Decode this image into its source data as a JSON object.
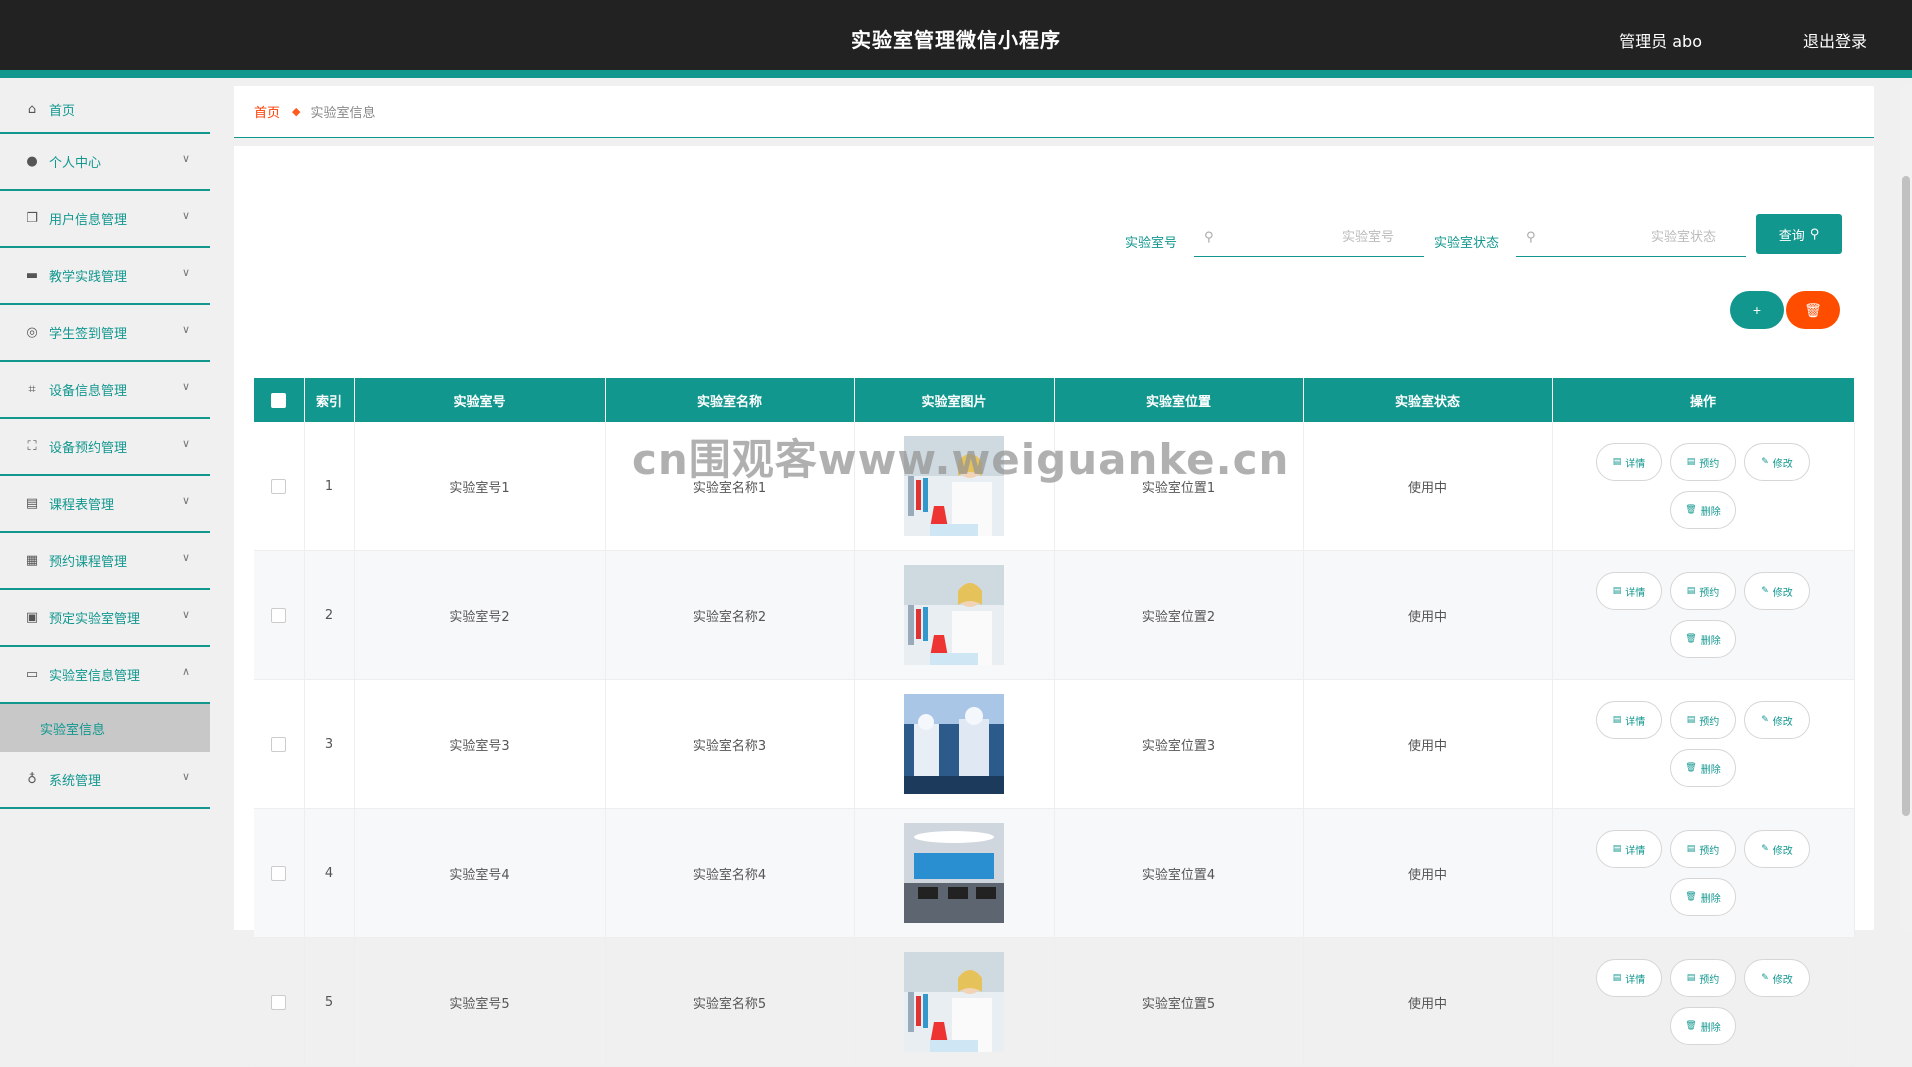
{
  "header": {
    "title": "实验室管理微信小程序",
    "user": "管理员 abo",
    "logout": "退出登录"
  },
  "sidebar": {
    "items": [
      {
        "label": "首页",
        "icon": "home-icon",
        "glyph": "⌂",
        "chevron": ""
      },
      {
        "label": "个人中心",
        "icon": "user-icon",
        "glyph": "●",
        "chevron": "∨"
      },
      {
        "label": "用户信息管理",
        "icon": "copy-icon",
        "glyph": "❐",
        "chevron": "∨"
      },
      {
        "label": "教学实践管理",
        "icon": "monitor-icon",
        "glyph": "▬",
        "chevron": "∨"
      },
      {
        "label": "学生签到管理",
        "icon": "target-icon",
        "glyph": "◎",
        "chevron": "∨"
      },
      {
        "label": "设备信息管理",
        "icon": "crop-icon",
        "glyph": "⌗",
        "chevron": "∨"
      },
      {
        "label": "设备预约管理",
        "icon": "fullscreen-icon",
        "glyph": "⛶",
        "chevron": "∨"
      },
      {
        "label": "课程表管理",
        "icon": "briefcase-icon",
        "glyph": "▤",
        "chevron": "∨"
      },
      {
        "label": "预约课程管理",
        "icon": "grid-icon",
        "glyph": "▦",
        "chevron": "∨"
      },
      {
        "label": "预定实验室管理",
        "icon": "clipboard-icon",
        "glyph": "▣",
        "chevron": "∨"
      },
      {
        "label": "实验室信息管理",
        "icon": "laptop-icon",
        "glyph": "▭",
        "chevron": "∧"
      },
      {
        "label": "实验室信息",
        "sub": true
      },
      {
        "label": "系统管理",
        "icon": "microphone-icon",
        "glyph": "♁",
        "chevron": "∨"
      }
    ]
  },
  "breadcrumb": {
    "home": "首页",
    "current": "实验室信息"
  },
  "search": {
    "lab_no_label": "实验室号",
    "lab_no_placeholder": "实验室号",
    "status_label": "实验室状态",
    "status_placeholder": "实验室状态",
    "query_label": "查询"
  },
  "actions": {
    "add": "+",
    "delete": "🗑"
  },
  "table": {
    "columns": [
      "索引",
      "实验室号",
      "实验室名称",
      "实验室图片",
      "实验室位置",
      "实验室状态",
      "操作"
    ],
    "rows": [
      {
        "index": "1",
        "lab_no": "实验室号1",
        "name": "实验室名称1",
        "image": "scientist-icon",
        "location": "实验室位置1",
        "status": "使用中"
      },
      {
        "index": "2",
        "lab_no": "实验室号2",
        "name": "实验室名称2",
        "image": "scientist-icon",
        "location": "实验室位置2",
        "status": "使用中"
      },
      {
        "index": "3",
        "lab_no": "实验室号3",
        "name": "实验室名称3",
        "image": "cleanroom-icon",
        "location": "实验室位置3",
        "status": "使用中"
      },
      {
        "index": "4",
        "lab_no": "实验室号4",
        "name": "实验室名称4",
        "image": "lab-room-icon",
        "location": "实验室位置4",
        "status": "使用中"
      },
      {
        "index": "5",
        "lab_no": "实验室号5",
        "name": "实验室名称5",
        "image": "scientist-icon",
        "location": "实验室位置5",
        "status": "使用中"
      }
    ],
    "op_labels": {
      "detail": "详情",
      "reserve": "预约",
      "edit": "修改",
      "remove": "删除"
    }
  },
  "watermark": "cn围观客www.weiguanke.cn",
  "colors": {
    "accent": "#12978f",
    "danger": "#ff4d00",
    "header_bg": "#222222"
  }
}
